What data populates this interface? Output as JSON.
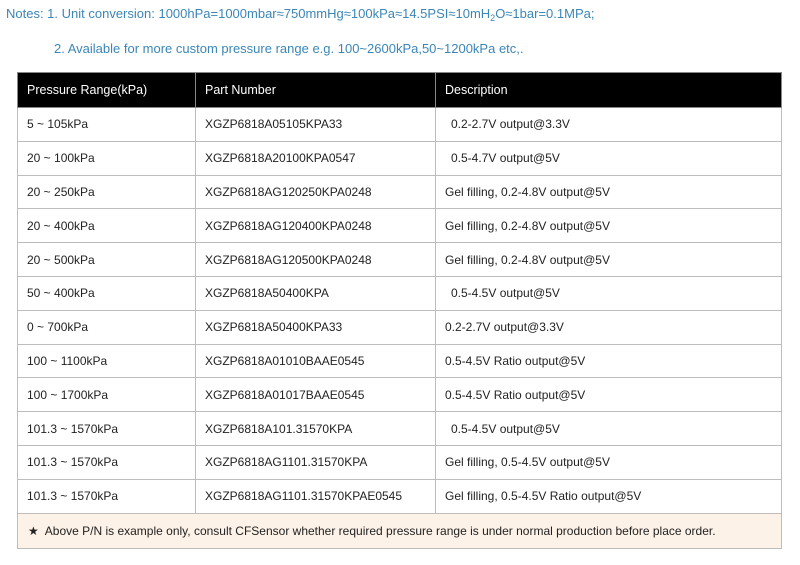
{
  "notes": {
    "line1_before_sub": "Notes: 1. Unit conversion: 1000hPa=1000mbar≈750mmHg≈100kPa≈14.5PSI≈10mH",
    "line1_sub": "2",
    "line1_after_sub": "O≈1bar=0.1MPa;",
    "line2": "2.  Available for more custom pressure range e.g. 100~2600kPa,50~1200kPa etc,."
  },
  "table": {
    "headers": [
      "Pressure Range(kPa)",
      "Part Number",
      "Description"
    ],
    "rows": [
      {
        "range": "5  ~  105kPa",
        "part": "XGZP6818A05105KPA33",
        "desc": "0.2-2.7V output@3.3V",
        "indent": true
      },
      {
        "range": "20  ~  100kPa",
        "part": "XGZP6818A20100KPA0547",
        "desc": "0.5-4.7V output@5V",
        "indent": true
      },
      {
        "range": "20  ~  250kPa",
        "part": "XGZP6818AG120250KPA0248",
        "desc": "Gel filling, 0.2-4.8V output@5V",
        "indent": false
      },
      {
        "range": "20  ~  400kPa",
        "part": "XGZP6818AG120400KPA0248",
        "desc": "Gel filling, 0.2-4.8V output@5V",
        "indent": false
      },
      {
        "range": "20  ~  500kPa",
        "part": "XGZP6818AG120500KPA0248",
        "desc": "Gel filling, 0.2-4.8V output@5V",
        "indent": false
      },
      {
        "range": "50  ~  400kPa",
        "part": "XGZP6818A50400KPA",
        "desc": "0.5-4.5V output@5V",
        "indent": true
      },
      {
        "range": "0  ~  700kPa",
        "part": "XGZP6818A50400KPA33",
        "desc": "0.2-2.7V output@3.3V",
        "indent": false
      },
      {
        "range": "100  ~  1100kPa",
        "part": "XGZP6818A01010BAAE0545",
        "desc": "0.5-4.5V Ratio output@5V",
        "indent": false
      },
      {
        "range": "100  ~  1700kPa",
        "part": "XGZP6818A01017BAAE0545",
        "desc": "0.5-4.5V Ratio output@5V",
        "indent": false
      },
      {
        "range": "101.3  ~  1570kPa",
        "part": "XGZP6818A101.31570KPA",
        "desc": "0.5-4.5V output@5V",
        "indent": true
      },
      {
        "range": "101.3  ~  1570kPa",
        "part": "XGZP6818AG1101.31570KPA",
        "desc": "Gel filling, 0.5-4.5V output@5V",
        "indent": false
      },
      {
        "range": "101.3  ~  1570kPa",
        "part": "XGZP6818AG1101.31570KPAE0545",
        "desc": "Gel filling, 0.5-4.5V Ratio output@5V",
        "indent": false
      }
    ],
    "footnote_star": "★",
    "footnote": "Above P/N is example only, consult CFSensor whether required pressure range is under normal production before place order."
  }
}
